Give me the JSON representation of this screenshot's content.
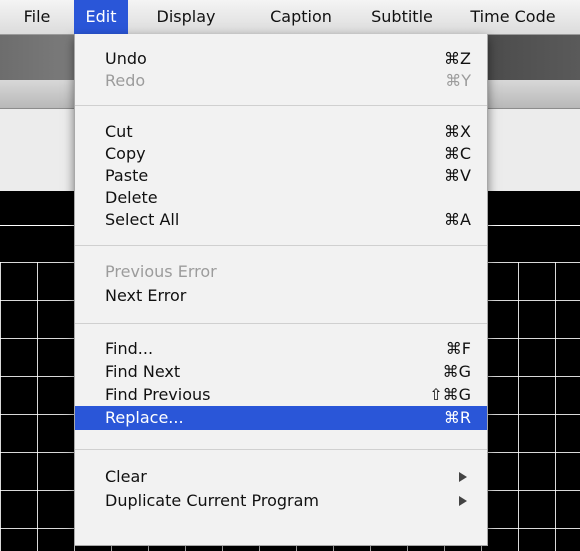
{
  "menubar": {
    "items": [
      {
        "label": "File"
      },
      {
        "label": "Edit"
      },
      {
        "label": "Display"
      },
      {
        "label": "Caption"
      },
      {
        "label": "Subtitle"
      },
      {
        "label": "Time Code"
      }
    ]
  },
  "edit_menu": {
    "items": [
      {
        "label": "Undo",
        "shortcut": "⌘Z",
        "enabled": true
      },
      {
        "label": "Redo",
        "shortcut": "⌘Y",
        "enabled": false
      },
      {
        "label": "Cut",
        "shortcut": "⌘X",
        "enabled": true
      },
      {
        "label": "Copy",
        "shortcut": "⌘C",
        "enabled": true
      },
      {
        "label": "Paste",
        "shortcut": "⌘V",
        "enabled": true
      },
      {
        "label": "Delete",
        "shortcut": "",
        "enabled": true
      },
      {
        "label": "Select All",
        "shortcut": "⌘A",
        "enabled": true
      },
      {
        "label": "Previous Error",
        "shortcut": "",
        "enabled": false
      },
      {
        "label": "Next Error",
        "shortcut": "",
        "enabled": true
      },
      {
        "label": "Find...",
        "shortcut": "⌘F",
        "enabled": true
      },
      {
        "label": "Find Next",
        "shortcut": "⌘G",
        "enabled": true
      },
      {
        "label": "Find Previous",
        "shortcut": "⇧⌘G",
        "enabled": true
      },
      {
        "label": "Replace...",
        "shortcut": "⌘R",
        "enabled": true,
        "highlighted": true
      },
      {
        "label": "Clear",
        "shortcut": "",
        "enabled": true,
        "submenu": true
      },
      {
        "label": "Duplicate Current Program",
        "shortcut": "",
        "enabled": true,
        "submenu": true
      }
    ]
  },
  "colors": {
    "accent": "#2a56d8",
    "menu_bg": "#f2f2f2",
    "disabled_text": "#9c9c9c"
  }
}
